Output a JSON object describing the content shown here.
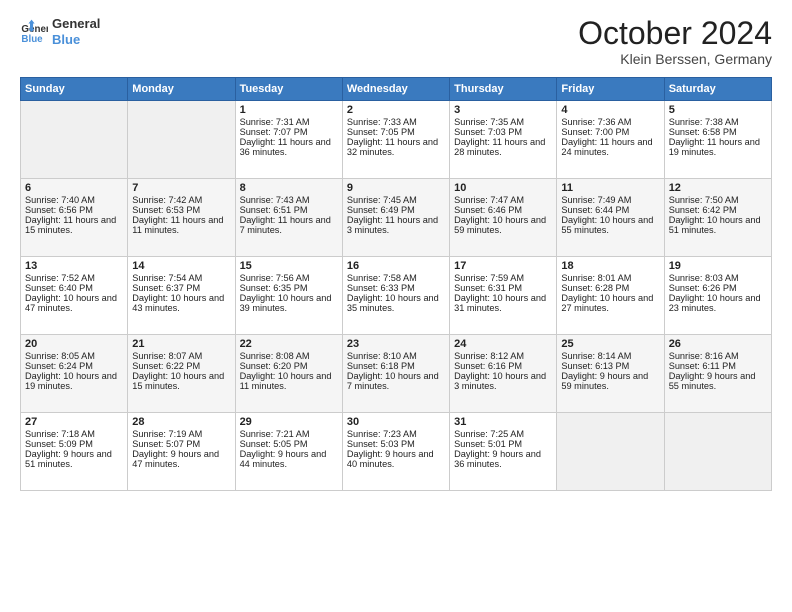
{
  "header": {
    "logo_line1": "General",
    "logo_line2": "Blue",
    "month": "October 2024",
    "location": "Klein Berssen, Germany"
  },
  "days_of_week": [
    "Sunday",
    "Monday",
    "Tuesday",
    "Wednesday",
    "Thursday",
    "Friday",
    "Saturday"
  ],
  "weeks": [
    [
      {
        "day": "",
        "sunrise": "",
        "sunset": "",
        "daylight": ""
      },
      {
        "day": "",
        "sunrise": "",
        "sunset": "",
        "daylight": ""
      },
      {
        "day": "1",
        "sunrise": "Sunrise: 7:31 AM",
        "sunset": "Sunset: 7:07 PM",
        "daylight": "Daylight: 11 hours and 36 minutes."
      },
      {
        "day": "2",
        "sunrise": "Sunrise: 7:33 AM",
        "sunset": "Sunset: 7:05 PM",
        "daylight": "Daylight: 11 hours and 32 minutes."
      },
      {
        "day": "3",
        "sunrise": "Sunrise: 7:35 AM",
        "sunset": "Sunset: 7:03 PM",
        "daylight": "Daylight: 11 hours and 28 minutes."
      },
      {
        "day": "4",
        "sunrise": "Sunrise: 7:36 AM",
        "sunset": "Sunset: 7:00 PM",
        "daylight": "Daylight: 11 hours and 24 minutes."
      },
      {
        "day": "5",
        "sunrise": "Sunrise: 7:38 AM",
        "sunset": "Sunset: 6:58 PM",
        "daylight": "Daylight: 11 hours and 19 minutes."
      }
    ],
    [
      {
        "day": "6",
        "sunrise": "Sunrise: 7:40 AM",
        "sunset": "Sunset: 6:56 PM",
        "daylight": "Daylight: 11 hours and 15 minutes."
      },
      {
        "day": "7",
        "sunrise": "Sunrise: 7:42 AM",
        "sunset": "Sunset: 6:53 PM",
        "daylight": "Daylight: 11 hours and 11 minutes."
      },
      {
        "day": "8",
        "sunrise": "Sunrise: 7:43 AM",
        "sunset": "Sunset: 6:51 PM",
        "daylight": "Daylight: 11 hours and 7 minutes."
      },
      {
        "day": "9",
        "sunrise": "Sunrise: 7:45 AM",
        "sunset": "Sunset: 6:49 PM",
        "daylight": "Daylight: 11 hours and 3 minutes."
      },
      {
        "day": "10",
        "sunrise": "Sunrise: 7:47 AM",
        "sunset": "Sunset: 6:46 PM",
        "daylight": "Daylight: 10 hours and 59 minutes."
      },
      {
        "day": "11",
        "sunrise": "Sunrise: 7:49 AM",
        "sunset": "Sunset: 6:44 PM",
        "daylight": "Daylight: 10 hours and 55 minutes."
      },
      {
        "day": "12",
        "sunrise": "Sunrise: 7:50 AM",
        "sunset": "Sunset: 6:42 PM",
        "daylight": "Daylight: 10 hours and 51 minutes."
      }
    ],
    [
      {
        "day": "13",
        "sunrise": "Sunrise: 7:52 AM",
        "sunset": "Sunset: 6:40 PM",
        "daylight": "Daylight: 10 hours and 47 minutes."
      },
      {
        "day": "14",
        "sunrise": "Sunrise: 7:54 AM",
        "sunset": "Sunset: 6:37 PM",
        "daylight": "Daylight: 10 hours and 43 minutes."
      },
      {
        "day": "15",
        "sunrise": "Sunrise: 7:56 AM",
        "sunset": "Sunset: 6:35 PM",
        "daylight": "Daylight: 10 hours and 39 minutes."
      },
      {
        "day": "16",
        "sunrise": "Sunrise: 7:58 AM",
        "sunset": "Sunset: 6:33 PM",
        "daylight": "Daylight: 10 hours and 35 minutes."
      },
      {
        "day": "17",
        "sunrise": "Sunrise: 7:59 AM",
        "sunset": "Sunset: 6:31 PM",
        "daylight": "Daylight: 10 hours and 31 minutes."
      },
      {
        "day": "18",
        "sunrise": "Sunrise: 8:01 AM",
        "sunset": "Sunset: 6:28 PM",
        "daylight": "Daylight: 10 hours and 27 minutes."
      },
      {
        "day": "19",
        "sunrise": "Sunrise: 8:03 AM",
        "sunset": "Sunset: 6:26 PM",
        "daylight": "Daylight: 10 hours and 23 minutes."
      }
    ],
    [
      {
        "day": "20",
        "sunrise": "Sunrise: 8:05 AM",
        "sunset": "Sunset: 6:24 PM",
        "daylight": "Daylight: 10 hours and 19 minutes."
      },
      {
        "day": "21",
        "sunrise": "Sunrise: 8:07 AM",
        "sunset": "Sunset: 6:22 PM",
        "daylight": "Daylight: 10 hours and 15 minutes."
      },
      {
        "day": "22",
        "sunrise": "Sunrise: 8:08 AM",
        "sunset": "Sunset: 6:20 PM",
        "daylight": "Daylight: 10 hours and 11 minutes."
      },
      {
        "day": "23",
        "sunrise": "Sunrise: 8:10 AM",
        "sunset": "Sunset: 6:18 PM",
        "daylight": "Daylight: 10 hours and 7 minutes."
      },
      {
        "day": "24",
        "sunrise": "Sunrise: 8:12 AM",
        "sunset": "Sunset: 6:16 PM",
        "daylight": "Daylight: 10 hours and 3 minutes."
      },
      {
        "day": "25",
        "sunrise": "Sunrise: 8:14 AM",
        "sunset": "Sunset: 6:13 PM",
        "daylight": "Daylight: 9 hours and 59 minutes."
      },
      {
        "day": "26",
        "sunrise": "Sunrise: 8:16 AM",
        "sunset": "Sunset: 6:11 PM",
        "daylight": "Daylight: 9 hours and 55 minutes."
      }
    ],
    [
      {
        "day": "27",
        "sunrise": "Sunrise: 7:18 AM",
        "sunset": "Sunset: 5:09 PM",
        "daylight": "Daylight: 9 hours and 51 minutes."
      },
      {
        "day": "28",
        "sunrise": "Sunrise: 7:19 AM",
        "sunset": "Sunset: 5:07 PM",
        "daylight": "Daylight: 9 hours and 47 minutes."
      },
      {
        "day": "29",
        "sunrise": "Sunrise: 7:21 AM",
        "sunset": "Sunset: 5:05 PM",
        "daylight": "Daylight: 9 hours and 44 minutes."
      },
      {
        "day": "30",
        "sunrise": "Sunrise: 7:23 AM",
        "sunset": "Sunset: 5:03 PM",
        "daylight": "Daylight: 9 hours and 40 minutes."
      },
      {
        "day": "31",
        "sunrise": "Sunrise: 7:25 AM",
        "sunset": "Sunset: 5:01 PM",
        "daylight": "Daylight: 9 hours and 36 minutes."
      },
      {
        "day": "",
        "sunrise": "",
        "sunset": "",
        "daylight": ""
      },
      {
        "day": "",
        "sunrise": "",
        "sunset": "",
        "daylight": ""
      }
    ]
  ]
}
